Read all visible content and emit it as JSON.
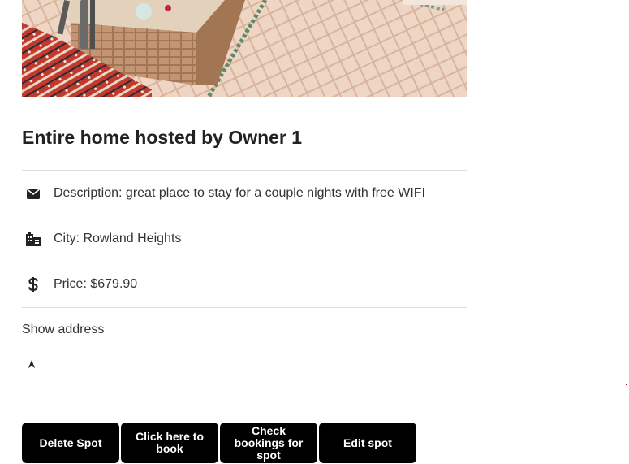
{
  "listing": {
    "image_alt": "Photo of the spot",
    "title": "Entire home hosted by Owner 1",
    "details": [
      {
        "icon": "envelope-icon",
        "text": "Description: great place to stay for a couple nights with free WIFI"
      },
      {
        "icon": "city-icon",
        "text": "City: Rowland Heights"
      },
      {
        "icon": "dollar-icon",
        "text": "Price: $679.90"
      }
    ]
  },
  "address": {
    "toggle_label": "Show address",
    "marker_icon": "map-pin-icon"
  },
  "actions": {
    "delete_label": "Delete Spot",
    "book_label": "Click here to book",
    "bookings_label": "Check bookings for spot",
    "edit_label": "Edit spot"
  },
  "colors": {
    "button_bg": "#000000",
    "button_text": "#ffffff",
    "divider": "#dddddd",
    "text": "#222222"
  }
}
